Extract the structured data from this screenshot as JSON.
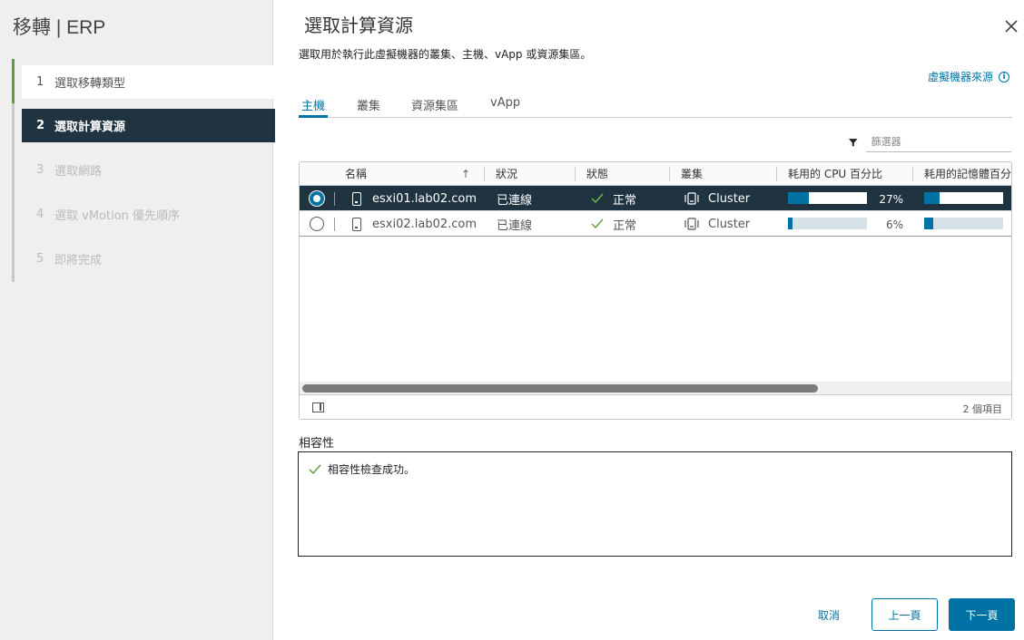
{
  "sidebar": {
    "title": "移轉 | ERP",
    "steps": [
      {
        "num": "1",
        "label": "選取移轉類型"
      },
      {
        "num": "2",
        "label": "選取計算資源"
      },
      {
        "num": "3",
        "label": "選取網路"
      },
      {
        "num": "4",
        "label": "選取 vMotion 優先順序"
      },
      {
        "num": "5",
        "label": "即將完成"
      }
    ],
    "current_step": 2
  },
  "main": {
    "title": "選取計算資源",
    "subtitle": "選取用於執行此虛擬機器的叢集、主機、vApp 或資源集區。",
    "source_link": "虛擬機器來源",
    "tabs": [
      "主機",
      "叢集",
      "資源集區",
      "vApp"
    ],
    "active_tab": "主機",
    "filter_placeholder": "篩選器"
  },
  "grid": {
    "columns": [
      "名稱",
      "狀況",
      "狀態",
      "叢集",
      "耗用的 CPU 百分比",
      "耗用的記憶體百分"
    ],
    "sort_column": "名稱",
    "rows": [
      {
        "name": "esxi01.lab02.com",
        "status": "已連線",
        "state": "正常",
        "cluster": "Cluster",
        "cpu_pct": "27%",
        "cpu_value": 0.27,
        "mem_value": 0.19,
        "selected": true
      },
      {
        "name": "esxi02.lab02.com",
        "status": "已連線",
        "state": "正常",
        "cluster": "Cluster",
        "cpu_pct": "6%",
        "cpu_value": 0.06,
        "mem_value": 0.11,
        "selected": false
      }
    ],
    "item_count": "2 個項目"
  },
  "compatibility": {
    "label": "相容性",
    "message": "相容性檢查成功。"
  },
  "buttons": {
    "cancel": "取消",
    "back": "上一頁",
    "next": "下一頁"
  },
  "colors": {
    "accent": "#0072a3",
    "sidebar_active": "#1f3440",
    "step_done": "#5d9c3c",
    "success": "#5d9c3c"
  },
  "icons": [
    "close-icon",
    "info-icon",
    "filter-icon",
    "sort-ascending-icon",
    "host-icon",
    "check-icon",
    "cluster-icon",
    "column-toggle-icon"
  ]
}
